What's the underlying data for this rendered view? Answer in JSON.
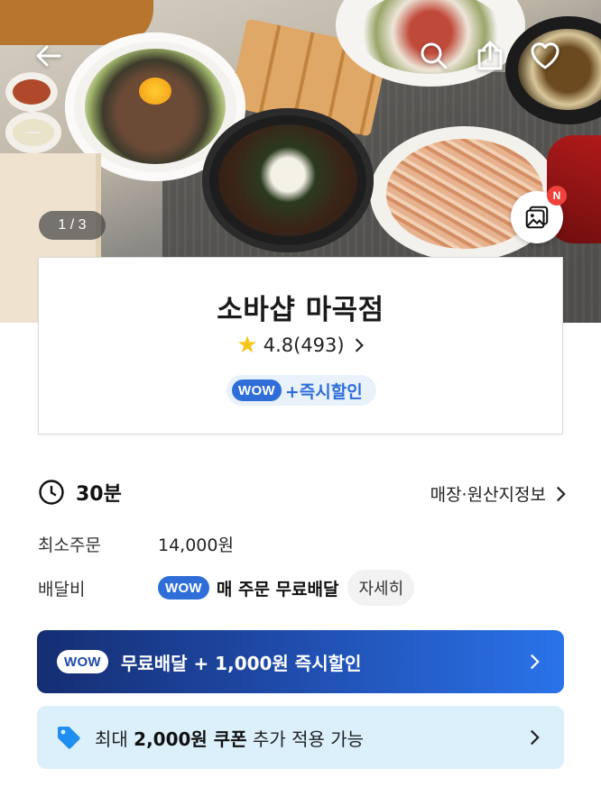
{
  "hero": {
    "image_counter": "1 / 3",
    "photo_badge": "N"
  },
  "store": {
    "name": "소바샵 마곡점",
    "rating": "4.8",
    "review_count": "(493)",
    "wow_tag": "WOW",
    "instant_discount": "+즉시할인"
  },
  "delivery": {
    "time": "30분",
    "store_info_link": "매장·원산지정보",
    "min_order_label": "최소주문",
    "min_order_value": "14,000원",
    "fee_label": "배달비",
    "fee_wow_tag": "WOW",
    "fee_value": "매 주문 무료배달",
    "detail_button": "자세히"
  },
  "banners": {
    "wow_tag": "WOW",
    "wow_text": "무료배달 + 1,000원 즉시할인",
    "coupon_prefix": "최대 ",
    "coupon_amount": "2,000원 쿠폰",
    "coupon_suffix": " 추가 적용 가능"
  },
  "icons": {
    "back": "arrow-left-icon",
    "search": "search-icon",
    "share": "share-icon",
    "favorite": "heart-icon",
    "photo_review": "photo-icon",
    "clock": "clock-icon",
    "coupon": "tag-icon"
  },
  "colors": {
    "wow_blue": "#2f6ed8",
    "banner_dark": "#152e72",
    "banner_light": "#2a73ea",
    "coupon_bg": "#dcf0fc",
    "badge_red": "#f0413e",
    "star": "#f5c518"
  }
}
